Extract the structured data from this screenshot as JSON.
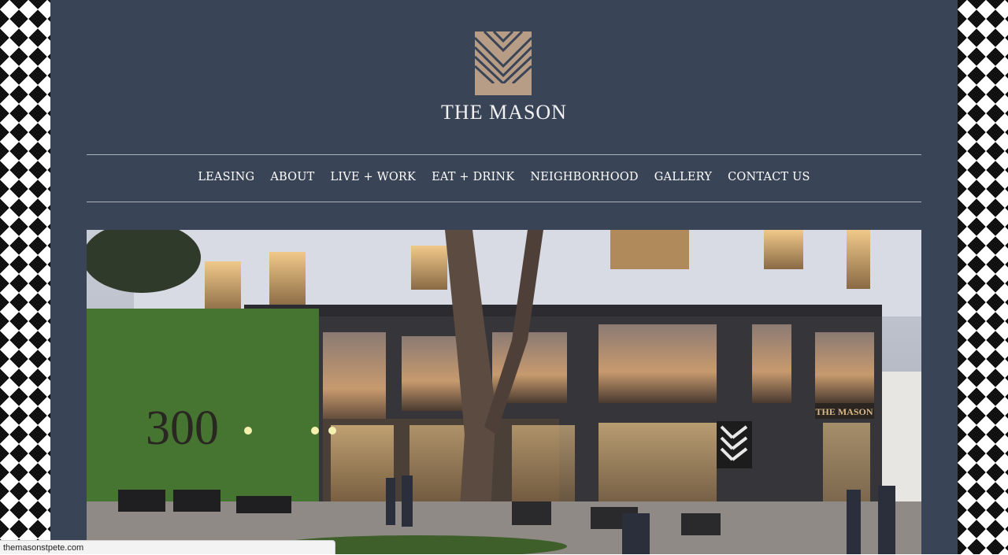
{
  "brand": {
    "name": "THE MASON",
    "colors": {
      "page_bg": "#3a4457",
      "logo_tan": "#b89d86",
      "logo_stripe": "#3a4457"
    }
  },
  "nav": {
    "items": [
      {
        "label": "LEASING"
      },
      {
        "label": "ABOUT"
      },
      {
        "label": "LIVE + WORK"
      },
      {
        "label": "EAT + DRINK"
      },
      {
        "label": "NEIGHBORHOOD"
      },
      {
        "label": "GALLERY"
      },
      {
        "label": "CONTACT US"
      }
    ]
  },
  "hero": {
    "address_number": "300",
    "storefront_sign": "THE MASON"
  },
  "statusbar": {
    "url": "themasonstpete.com"
  }
}
